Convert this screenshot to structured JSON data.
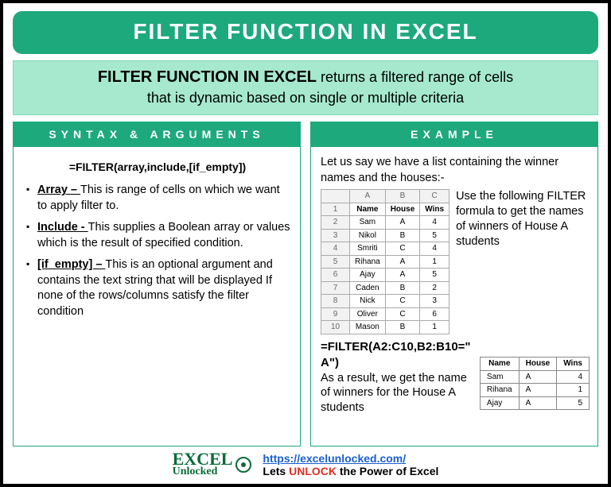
{
  "title": "FILTER FUNCTION IN EXCEL",
  "subtitle": {
    "bold": "FILTER FUNCTION IN EXCEL",
    "rest1": " returns a filtered range of cells",
    "rest2": "that is dynamic based on single or multiple criteria"
  },
  "left": {
    "header": "SYNTAX & ARGUMENTS",
    "formula": "=FILTER(array,include,[if_empty])",
    "args": [
      {
        "name": "Array – ",
        "desc": "This is range of cells on which we want to apply filter to."
      },
      {
        "name": "Include -  ",
        "desc": "This supplies a Boolean array or values which is the result of specified condition."
      },
      {
        "name": "[if_empty] – ",
        "desc": "This is an optional argument and contains the text string that will be displayed If none of the rows/columns satisfy the filter condition"
      }
    ]
  },
  "right": {
    "header": "EXAMPLE",
    "intro": "Let us say we have a list containing the winner names and the houses:-",
    "table": {
      "cols": [
        "",
        "A",
        "B",
        "C"
      ],
      "head": [
        "1",
        "Name",
        "House",
        "Wins"
      ],
      "rows": [
        [
          "2",
          "Sam",
          "A",
          "4"
        ],
        [
          "3",
          "Nikol",
          "B",
          "5"
        ],
        [
          "4",
          "Smriti",
          "C",
          "4"
        ],
        [
          "5",
          "Rihana",
          "A",
          "1"
        ],
        [
          "6",
          "Ajay",
          "A",
          "5"
        ],
        [
          "7",
          "Caden",
          "B",
          "2"
        ],
        [
          "8",
          "Nick",
          "C",
          "3"
        ],
        [
          "9",
          "Oliver",
          "C",
          "6"
        ],
        [
          "10",
          "Mason",
          "B",
          "1"
        ]
      ]
    },
    "side_text": "Use the following FILTER formula to get the names of winners of House A students",
    "formula_line1": "=FILTER(A2:C10,B2:B10=\"",
    "formula_line2": "A\")",
    "result_text": "As a result, we get the name of winners for the House A students",
    "result_table": {
      "head": [
        "Name",
        "House",
        "Wins"
      ],
      "rows": [
        [
          "Sam",
          "A",
          "4"
        ],
        [
          "Rihana",
          "A",
          "1"
        ],
        [
          "Ajay",
          "A",
          "5"
        ]
      ]
    }
  },
  "footer": {
    "logo_top": "EXCEL",
    "logo_bottom": "Unlocked",
    "url": "https://excelunlocked.com/",
    "tag_pre": "Lets ",
    "tag_unlock": "UNLOCK",
    "tag_post": " the Power of Excel"
  }
}
